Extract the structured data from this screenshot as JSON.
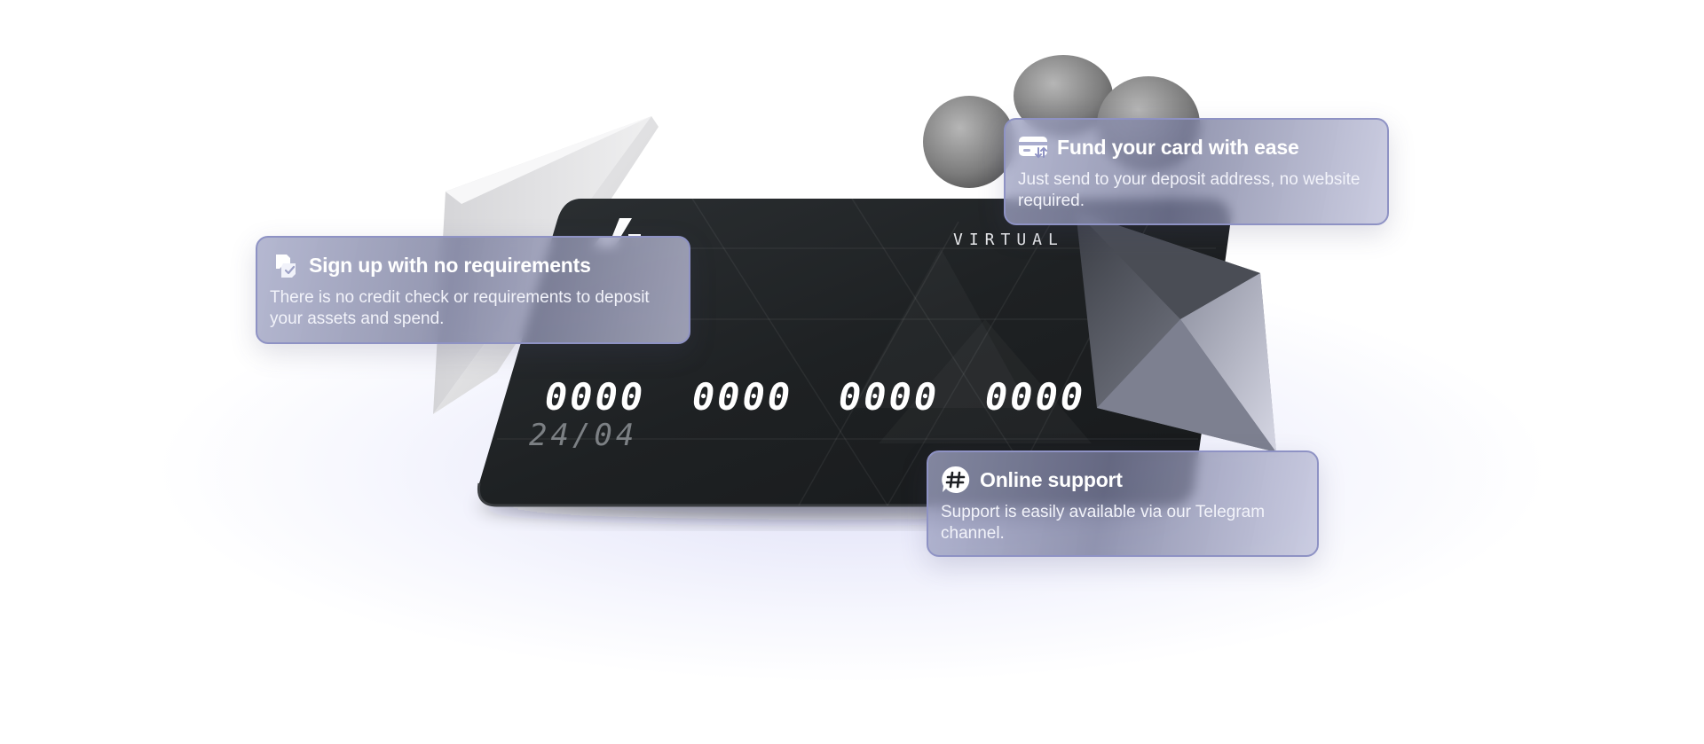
{
  "card": {
    "label": "VIRTUAL C",
    "number_groups": [
      "0000",
      "0000",
      "0000",
      "0000"
    ],
    "expiry": "24/04"
  },
  "features": {
    "signup": {
      "icon": "badge-check-icon",
      "title": "Sign up with no requirements",
      "description": "There is no credit check or requirements to deposit your assets and spend."
    },
    "fund": {
      "icon": "card-transfer-icon",
      "title": "Fund your card with ease",
      "description": "Just send to your deposit address, no website required."
    },
    "support": {
      "icon": "hash-chat-icon",
      "title": "Online support",
      "description": "Support is easily available via our Telegram channel."
    }
  },
  "colors": {
    "card_body": "#1f2225",
    "callout_border": "#8e92c4",
    "background_glow": "#c4c6f0"
  }
}
